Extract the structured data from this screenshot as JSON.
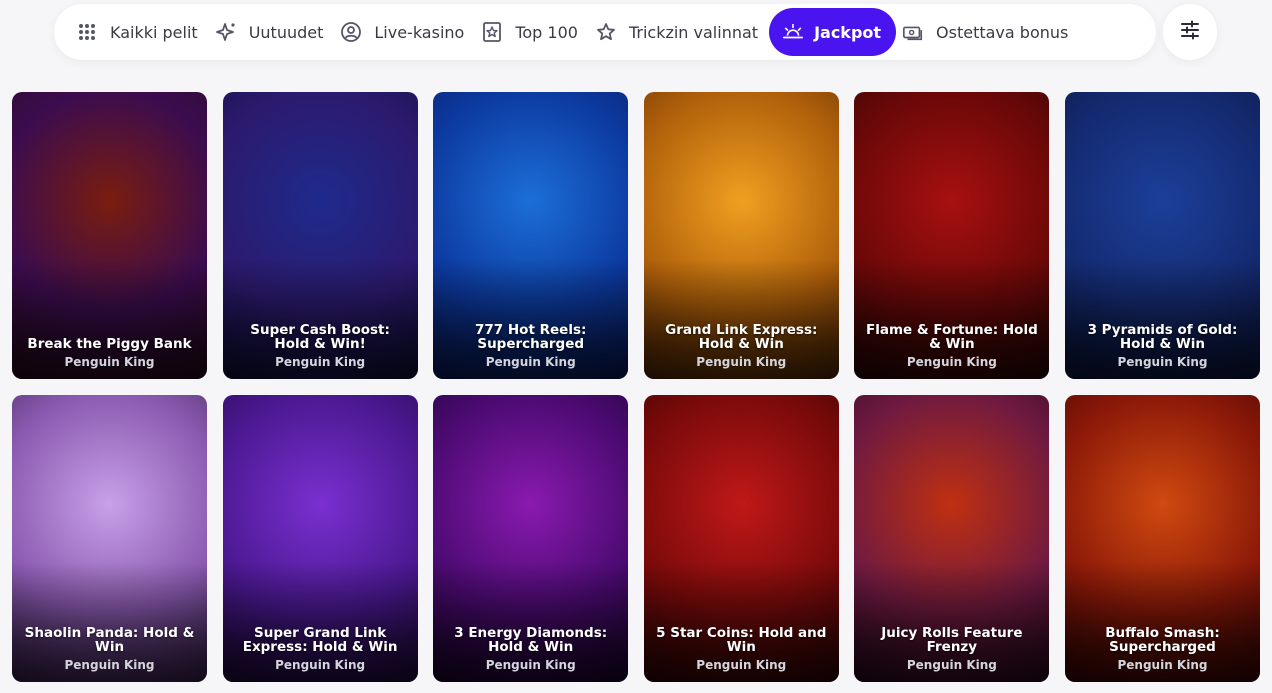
{
  "nav": {
    "tabs": [
      {
        "label": "Kaikki pelit",
        "icon": "grid-dots-icon"
      },
      {
        "label": "Uutuudet",
        "icon": "sparkle-icon"
      },
      {
        "label": "Live-kasino",
        "icon": "user-circle-icon"
      },
      {
        "label": "Top 100",
        "icon": "star-badge-icon"
      },
      {
        "label": "Trickzin valinnat",
        "icon": "star-icon"
      },
      {
        "label": "Jackpot",
        "icon": "sunrise-icon",
        "active": true
      },
      {
        "label": "Ostettava bonus",
        "icon": "cash-icon"
      }
    ],
    "filter_icon": "sliders-icon",
    "accent": "#4a14f0"
  },
  "games": [
    {
      "title": "Break the Piggy Bank",
      "provider": "Penguin King",
      "colors": [
        "#7a1d0e",
        "#3b0c4f",
        "#2a0a1c"
      ]
    },
    {
      "title": "Super Cash Boost: Hold & Win!",
      "provider": "Penguin King",
      "colors": [
        "#1e2a8c",
        "#2c1a6e",
        "#0f0f40"
      ]
    },
    {
      "title": "777 Hot Reels: Supercharged",
      "provider": "Penguin King",
      "colors": [
        "#1c6fd8",
        "#0c3aa0",
        "#0a1a60"
      ]
    },
    {
      "title": "Grand Link Express: Hold & Win",
      "provider": "Penguin King",
      "colors": [
        "#f0a020",
        "#b0600a",
        "#5a2a05"
      ]
    },
    {
      "title": "Flame & Fortune: Hold & Win",
      "provider": "Penguin King",
      "colors": [
        "#a81010",
        "#6a0808",
        "#2a0404"
      ]
    },
    {
      "title": "3 Pyramids of Gold: Hold & Win",
      "provider": "Penguin King",
      "colors": [
        "#1c3f9a",
        "#142a70",
        "#0a1440"
      ]
    },
    {
      "title": "Shaolin Panda: Hold & Win",
      "provider": "Penguin King",
      "colors": [
        "#c8a0e8",
        "#8a5ab0",
        "#3a2050"
      ]
    },
    {
      "title": "Super Grand Link Express: Hold & Win",
      "provider": "Penguin King",
      "colors": [
        "#7a30d0",
        "#4a1890",
        "#200a40"
      ]
    },
    {
      "title": "3 Energy Diamonds: Hold & Win",
      "provider": "Penguin King",
      "colors": [
        "#8a1ab0",
        "#4a0a70",
        "#1a0430"
      ]
    },
    {
      "title": "5 Star Coins: Hold and Win",
      "provider": "Penguin King",
      "colors": [
        "#c01818",
        "#7a0a0a",
        "#300404"
      ]
    },
    {
      "title": "Juicy Rolls Feature Frenzy",
      "provider": "Penguin King",
      "colors": [
        "#c03010",
        "#701a40",
        "#2a0820"
      ]
    },
    {
      "title": "Buffalo Smash: Supercharged",
      "provider": "Penguin King",
      "colors": [
        "#d04a10",
        "#8a1808",
        "#3a0404"
      ]
    }
  ]
}
